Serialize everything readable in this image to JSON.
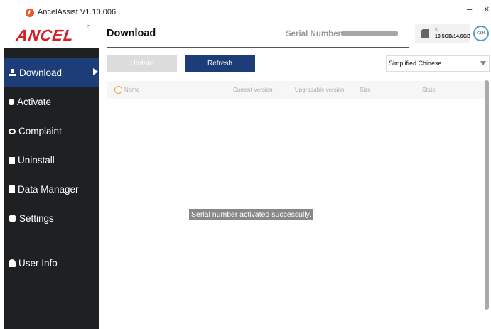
{
  "window": {
    "title": "AncelAssist  V1.10.006",
    "minimize_label": "–",
    "close_label": "×"
  },
  "brand": {
    "logo_text": "ANCEL",
    "accent": "#1c3d78",
    "logo_color": "#d61f26"
  },
  "sidebar": {
    "items": [
      {
        "label": "Download",
        "icon": "download-icon",
        "active": true
      },
      {
        "label": "Activate",
        "icon": "bulb-icon",
        "active": false
      },
      {
        "label": "Complaint",
        "icon": "complaint-icon",
        "active": false
      },
      {
        "label": "Uninstall",
        "icon": "trash-icon",
        "active": false
      },
      {
        "label": "Data Manager",
        "icon": "clipboard-icon",
        "active": false
      },
      {
        "label": "Settings",
        "icon": "gear-icon",
        "active": false
      },
      {
        "label": "User Info",
        "icon": "user-icon",
        "active": false
      }
    ]
  },
  "header": {
    "page_title": "Download",
    "serial_label": "Serial Number:",
    "storage_label": "0/",
    "storage_value": "10.5GB/14.6GB",
    "battery_percent": "72%"
  },
  "toolbar": {
    "update_label": "Update",
    "refresh_label": "Refresh",
    "language_selected": "Simplified Chinese"
  },
  "table": {
    "columns": [
      "Name",
      "Current Version",
      "Upgradable version",
      "Size",
      "State"
    ],
    "rows": []
  },
  "toast": {
    "message": "Serial number activated successully."
  }
}
